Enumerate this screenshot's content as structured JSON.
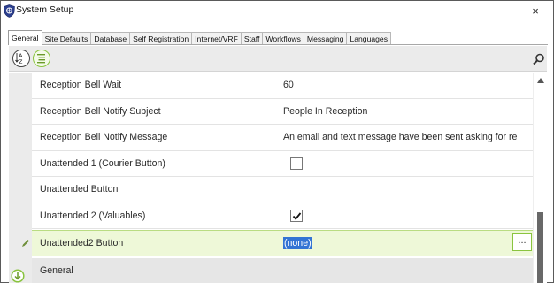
{
  "window": {
    "title": "System Setup",
    "close_label": "×"
  },
  "tabs": [
    {
      "label": "General",
      "active": true
    },
    {
      "label": "Site Defaults",
      "active": false
    },
    {
      "label": "Database",
      "active": false
    },
    {
      "label": "Self Registration",
      "active": false
    },
    {
      "label": "Internet/VRF",
      "active": false
    },
    {
      "label": "Staff",
      "active": false
    },
    {
      "label": "Workflows",
      "active": false
    },
    {
      "label": "Messaging",
      "active": false
    },
    {
      "label": "Languages",
      "active": false
    }
  ],
  "toolbar": {
    "sort_icon": "sort-az-icon",
    "categorized_icon": "categorized-icon",
    "search_icon": "search-icon"
  },
  "properties": [
    {
      "label": "Reception Bell Wait",
      "value": "60",
      "type": "text"
    },
    {
      "label": "Reception Bell Notify Subject",
      "value": "People In Reception",
      "type": "text"
    },
    {
      "label": "Reception Bell Notify Message",
      "value": "An email and text message have been sent asking for re",
      "type": "text"
    },
    {
      "label": "Unattended 1 (Courier Button)",
      "value": "",
      "type": "checkbox",
      "checked": false
    },
    {
      "label": "Unattended Button",
      "value": "",
      "type": "text"
    },
    {
      "label": "Unattended 2 (Valuables)",
      "value": "",
      "type": "checkbox",
      "checked": true
    }
  ],
  "selected_property": {
    "label": "Unattended2 Button",
    "value": "(none)",
    "button_label": "..."
  },
  "category": {
    "label": "General"
  },
  "colors": {
    "accent_green": "#8ac43f",
    "selection_bg": "#eef8d8",
    "text_highlight": "#3374d4"
  }
}
